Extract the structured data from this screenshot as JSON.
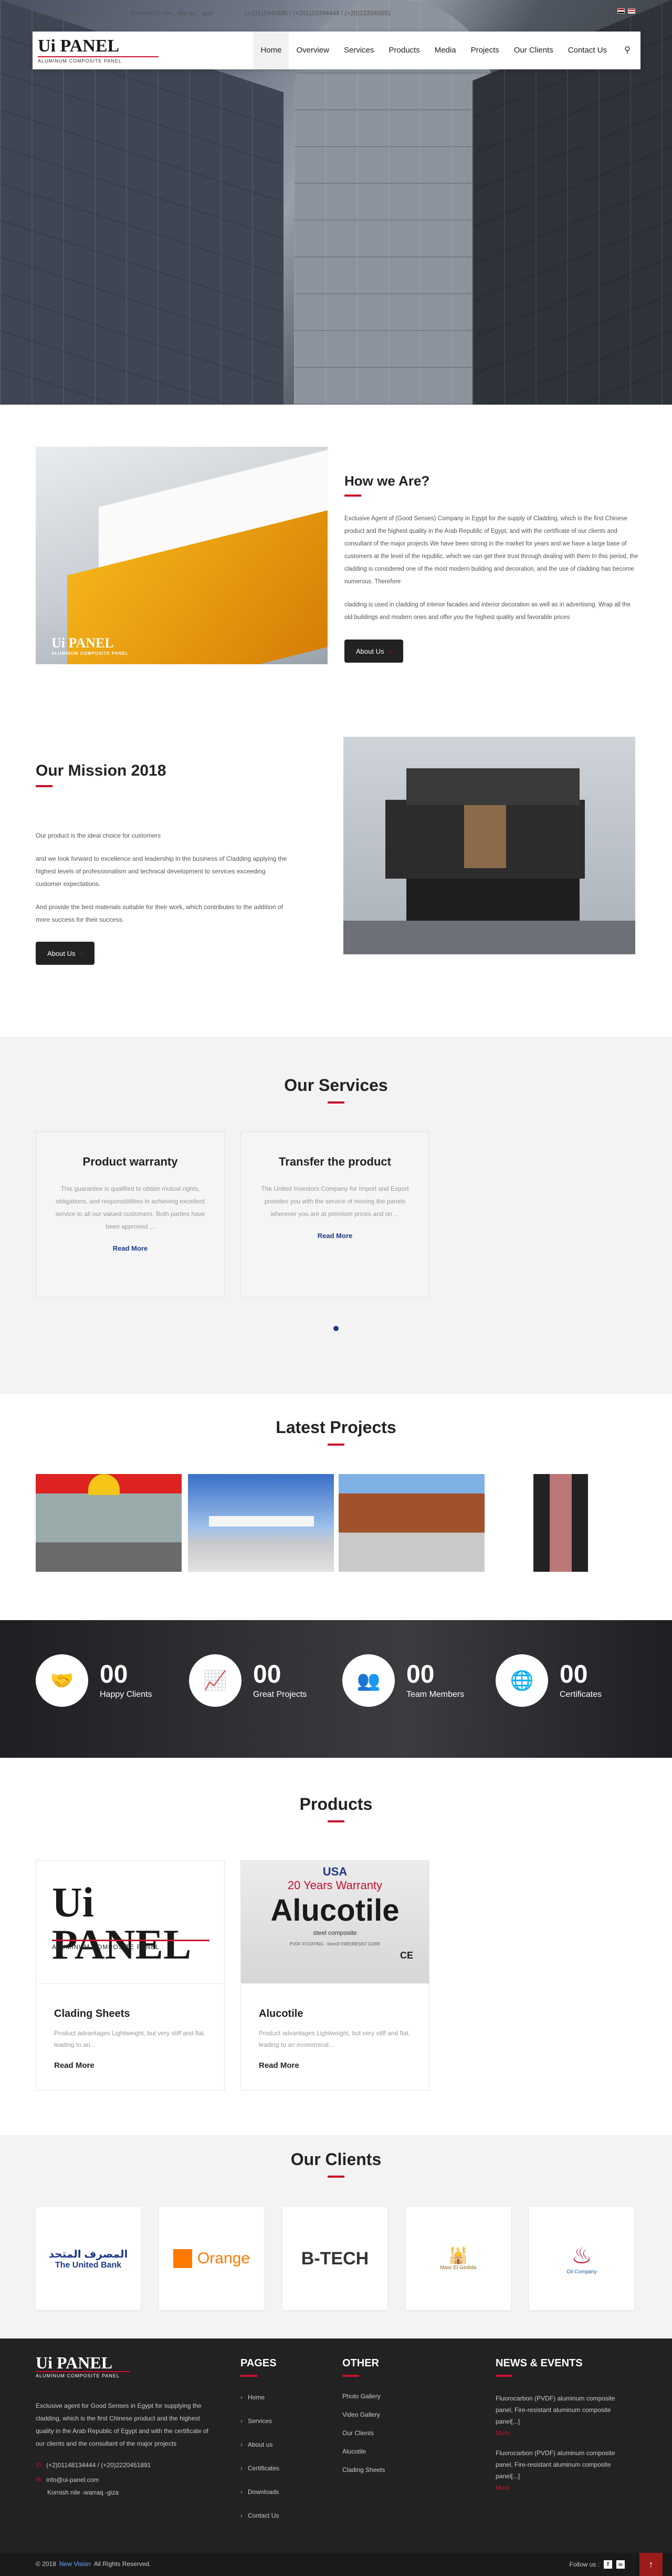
{
  "topbar": {
    "phone": "01200-100 - 033",
    "email": "info@ui-panel.com",
    "address": "Kornish El-nile , warraq , giza",
    "hotline": "(+201)2446695 / (+201)15394444 / (+20)222045891"
  },
  "nav": {
    "logo_text": "Ui PANEL",
    "logo_sub": "ALUMINUM COMPOSITE PANEL",
    "items": [
      "Home",
      "Overview",
      "Services",
      "Products",
      "Media",
      "Projects",
      "Our Clients",
      "Contact Us"
    ],
    "search_icon": "search-icon"
  },
  "who": {
    "title": "How we Are?",
    "p1": "Exclusive Agent of (Good Senses) Company in Egypt for the supply of Cladding, which is the first Chinese product and the highest quality in the Arab Republic of Egypt, and with the certificate of our clients and consultant of the major projects We have been strong in the market for years and we have a large base of customers at the level of the republic, which we can get their trust through dealing with them In this period, the cladding is considered one of the most modern building and decoration, and the use of cladding has become numerous. Therefore",
    "p2": "cladding is used in cladding of interior facades and interior decoration as well as in advertising. Wrap all the old buildings and modern ones and offer you the highest quality and favorable prices",
    "button": "About Us",
    "image_label": "Ui PANEL",
    "image_sub": "ALUMINUM COMPOSITE PANEL"
  },
  "mission": {
    "title": "Our Mission 2018",
    "p1": "Our product is the ideal choice for customers",
    "p2": "and we look forward to excellence and leadership in the business of Cladding applying the highest levels of professionalism and technical development to services exceeding customer expectations.",
    "p3": "And provide the best materials suitable for their work, which contributes to the addition of more success for their success.",
    "button": "About Us"
  },
  "services": {
    "title": "Our Services",
    "cards": [
      {
        "title": "Product warranty",
        "text": "This guarantee is qualified to obtain mutual rights, obligations, and responsibilities in achieving excellent service to all our valued customers. Both parties have been approved ...",
        "link": "Read More"
      },
      {
        "title": "Transfer the product",
        "text": "The United Investors Company for Import and Export provides you with the service of moving the panels wherever you are at premium prices and on ...",
        "link": "Read More"
      }
    ]
  },
  "projects": {
    "title": "Latest Projects"
  },
  "stats": [
    {
      "icon": "handshake-icon",
      "value": "00",
      "label": "Happy Clients"
    },
    {
      "icon": "presentation-icon",
      "value": "00",
      "label": "Great Projects"
    },
    {
      "icon": "team-icon",
      "value": "00",
      "label": "Team Members"
    },
    {
      "icon": "globe-icon",
      "value": "00",
      "label": "Certificates"
    }
  ],
  "products": {
    "title": "Products",
    "items": [
      {
        "name": "Clading Sheets",
        "text": "Product advantages Lightweight, but very stiff and flat, leading to an...",
        "link": "Read More",
        "brand": "Ui PANEL",
        "brand_sub": "ALUMINUM COMPOSITE PANEL"
      },
      {
        "name": "Alucotile",
        "text": "Product advantages Lightweight, but very stiff and flat, leading to an economical...",
        "link": "Read More",
        "brand_top": "USA",
        "brand_warranty": "20 Years Warranty",
        "brand": "Alucotile",
        "brand_sub": "steel composite",
        "brand_fine": "PVDF FCOATING · 0mm3/ FIRE/RESIST CORE",
        "brand_ce": "CE"
      }
    ]
  },
  "clients": {
    "title": "Our Clients",
    "names": [
      "The United Bank",
      "Orange",
      "B-TECH",
      "Masr El Gedida",
      "Oil Company"
    ],
    "arabic": "المصرف المتحد"
  },
  "footer": {
    "logo_text": "Ui PANEL",
    "logo_sub": "ALUMINUM COMPOSITE PANEL",
    "about": "Exclusive agent for Good Senses in Egypt for supplying the cladding, which is the first Chinese product and the highest quality in the Arab Republic of Egypt and with the certificate of our clients and the consultant of the major projects",
    "phone": "(+2)01148134444 / (+20)2220451891",
    "email": "info@ui-panel.com",
    "address": "Kornish nile -warraq -giza",
    "pages_title": "PAGES",
    "pages": [
      "Home",
      "Services",
      "About us",
      "Certificates",
      "Downloads",
      "Contact Us"
    ],
    "other_title": "OTHER",
    "other": [
      "Photo Gallery",
      "Video Gallery",
      "Our Clients",
      "Alucotile",
      "Clading Sheets"
    ],
    "news_title": "NEWS & EVENTS",
    "news": [
      {
        "text": "Fluorocarbon (PVDF) aluminum composite panel, Fire-resistant aluminum composite panel[...]",
        "link": "More"
      },
      {
        "text": "Fluorocarbon (PVDF) aluminum composite panel, Fire-resistant aluminum composite panel[...]",
        "link": "More"
      }
    ],
    "copyright": "© 2018",
    "brand": "New Vision",
    "rights": "All Rights Reserved.",
    "follow": "Follow us :"
  },
  "colors": {
    "accent": "#c8102e",
    "dark": "#222222",
    "link": "#1e3a8a"
  }
}
